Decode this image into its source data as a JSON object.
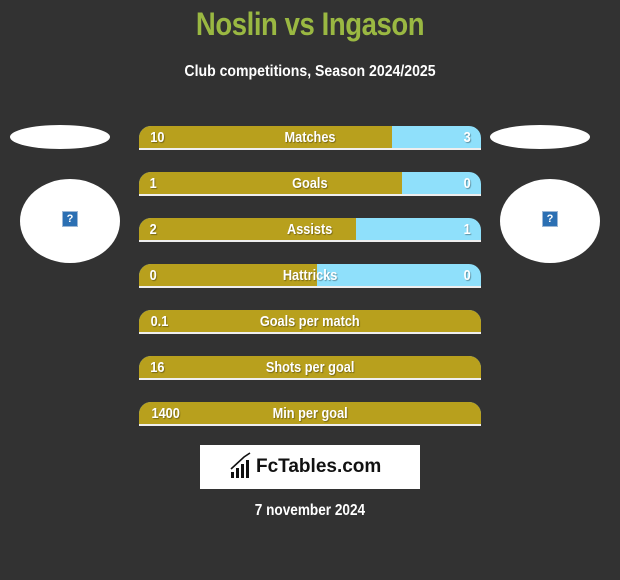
{
  "header": {
    "title": "Noslin vs Ingason",
    "subtitle": "Club competitions, Season 2024/2025"
  },
  "players": {
    "left": {
      "name": "Noslin",
      "avatar_icon": "question-mark-icon"
    },
    "right": {
      "name": "Ingason",
      "avatar_icon": "question-mark-icon"
    }
  },
  "colors": {
    "title": "#9ab842",
    "left_bar": "#b8a01d",
    "right_bar": "#8fe0fb",
    "background": "#323232"
  },
  "stats": [
    {
      "label": "Matches",
      "left": "10",
      "right": "3",
      "left_share": 0.74
    },
    {
      "label": "Goals",
      "left": "1",
      "right": "0",
      "left_share": 0.77
    },
    {
      "label": "Assists",
      "left": "2",
      "right": "1",
      "left_share": 0.635
    },
    {
      "label": "Hattricks",
      "left": "0",
      "right": "0",
      "left_share": 0.52
    },
    {
      "label": "Goals per match",
      "left": "0.1",
      "right": "",
      "left_share": 1
    },
    {
      "label": "Shots per goal",
      "left": "16",
      "right": "",
      "left_share": 1
    },
    {
      "label": "Min per goal",
      "left": "1400",
      "right": "",
      "left_share": 1
    }
  ],
  "footer": {
    "logo_text": "FcTables.com",
    "logo_icon": "bar-chart-icon",
    "date": "7 november 2024"
  }
}
